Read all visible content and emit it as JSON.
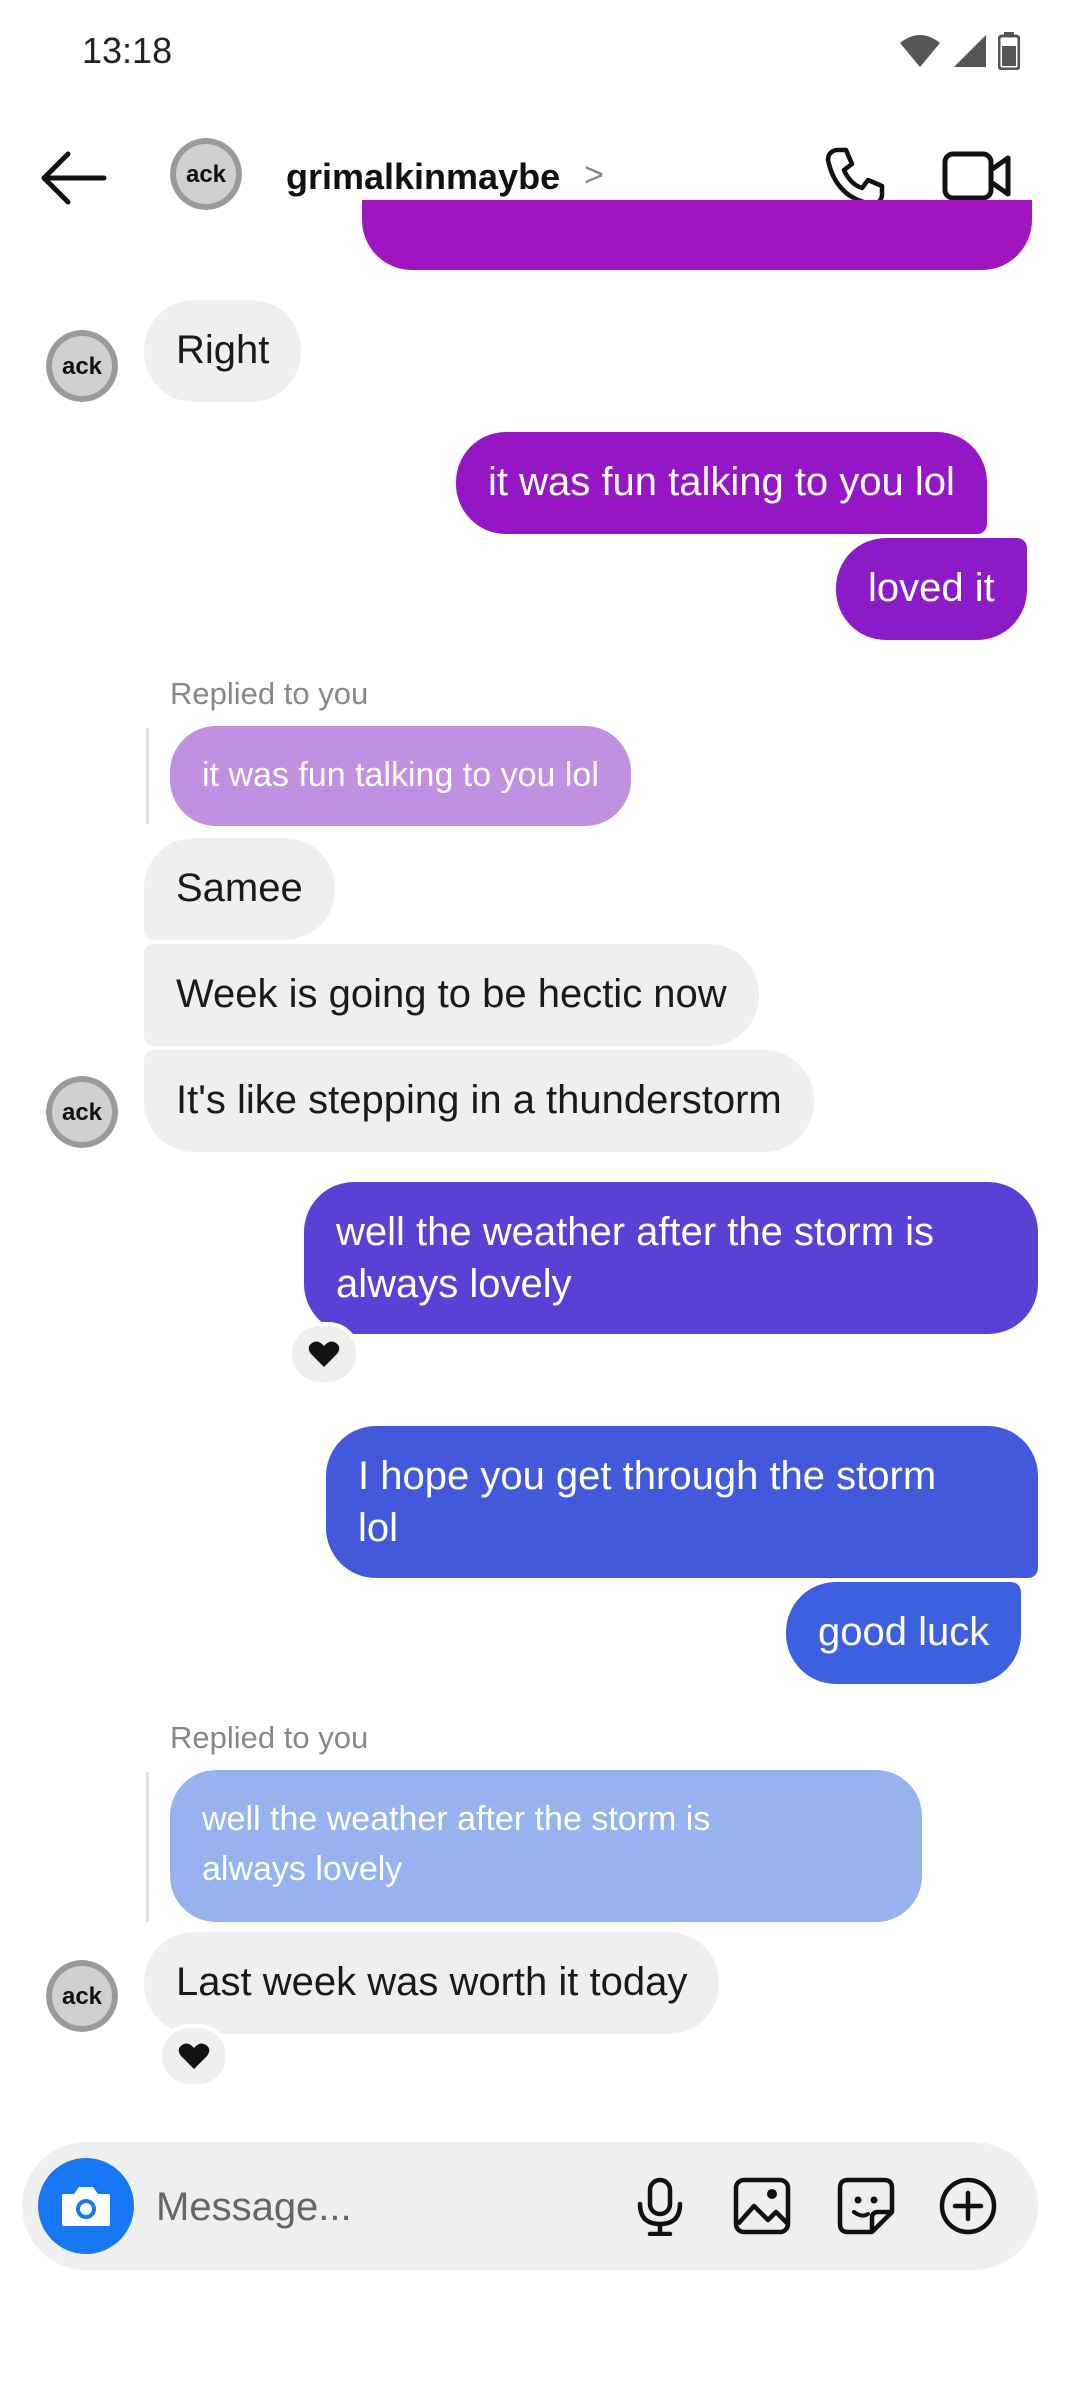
{
  "status_bar": {
    "time": "13:18"
  },
  "header": {
    "username": "grimalkinmaybe",
    "chevron": ">"
  },
  "messages": {
    "m1": "Right",
    "m2": "it was fun talking to you lol",
    "m3": "loved it",
    "m4_reply_label": "Replied to you",
    "m4_quote": "it was fun talking to you lol",
    "m5": "Samee",
    "m6": "Week is going to be hectic now",
    "m7": "It's like stepping in a thunderstorm",
    "m8_line1": "well the weather after the storm is",
    "m8_line2": "always lovely",
    "m9_line1": "I hope you get through the storm",
    "m9_line2": "lol",
    "m10": "good luck",
    "m11_reply_label": "Replied to you",
    "m11_quote_line1": "well the weather after the storm is",
    "m11_quote_line2": "always lovely",
    "m12": "Last week was worth it today"
  },
  "composer": {
    "placeholder": "Message..."
  },
  "icons": {
    "back": "arrow-left-icon",
    "call": "phone-icon",
    "video": "video-camera-icon",
    "camera": "camera-icon",
    "mic": "microphone-icon",
    "gallery": "image-icon",
    "sticker": "sticker-icon",
    "add": "plus-circle-icon",
    "reaction": "heart-icon"
  },
  "colors": {
    "out_top": "#9a16c4",
    "out_mid": "#5a3fd4",
    "out_bottom": "#3f5fe0",
    "in_bubble": "#efefef",
    "camera_button": "#1877f2"
  }
}
